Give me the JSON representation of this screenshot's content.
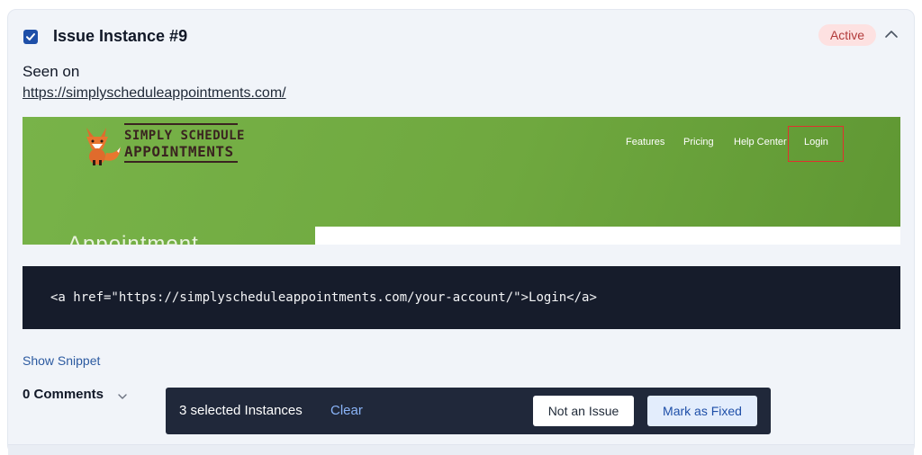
{
  "instance": {
    "title": "Issue Instance #9",
    "checked": true,
    "status": "Active",
    "seen_on_label": "Seen on",
    "seen_on_url": "https://simplyscheduleappointments.com/"
  },
  "preview": {
    "logo_line1": "SIMPLY SCHEDULE",
    "logo_line2": "APPOINTMENTS",
    "nav": [
      "Features",
      "Pricing",
      "Help Center",
      "Login"
    ],
    "hero_partial": "Appointment"
  },
  "snippet": {
    "code": "<a href=\"https://simplyscheduleappointments.com/your-account/\">Login</a>",
    "show_label": "Show Snippet"
  },
  "comments": {
    "label": "0 Comments"
  },
  "action_bar": {
    "selected_text": "3 selected Instances",
    "clear_label": "Clear",
    "not_issue_label": "Not an Issue",
    "mark_fixed_label": "Mark as Fixed"
  },
  "colors": {
    "accent": "#1e4fa8",
    "badge_bg": "#fde1e1",
    "badge_text": "#b23b3b",
    "preview_green": "#6fa83f",
    "code_bg": "#161c2b",
    "action_bar_bg": "#20283a"
  },
  "icons": {
    "checkbox": "check-icon",
    "collapse": "chevron-up-icon",
    "comments_toggle": "chevron-down-icon",
    "logo": "fox-icon"
  }
}
